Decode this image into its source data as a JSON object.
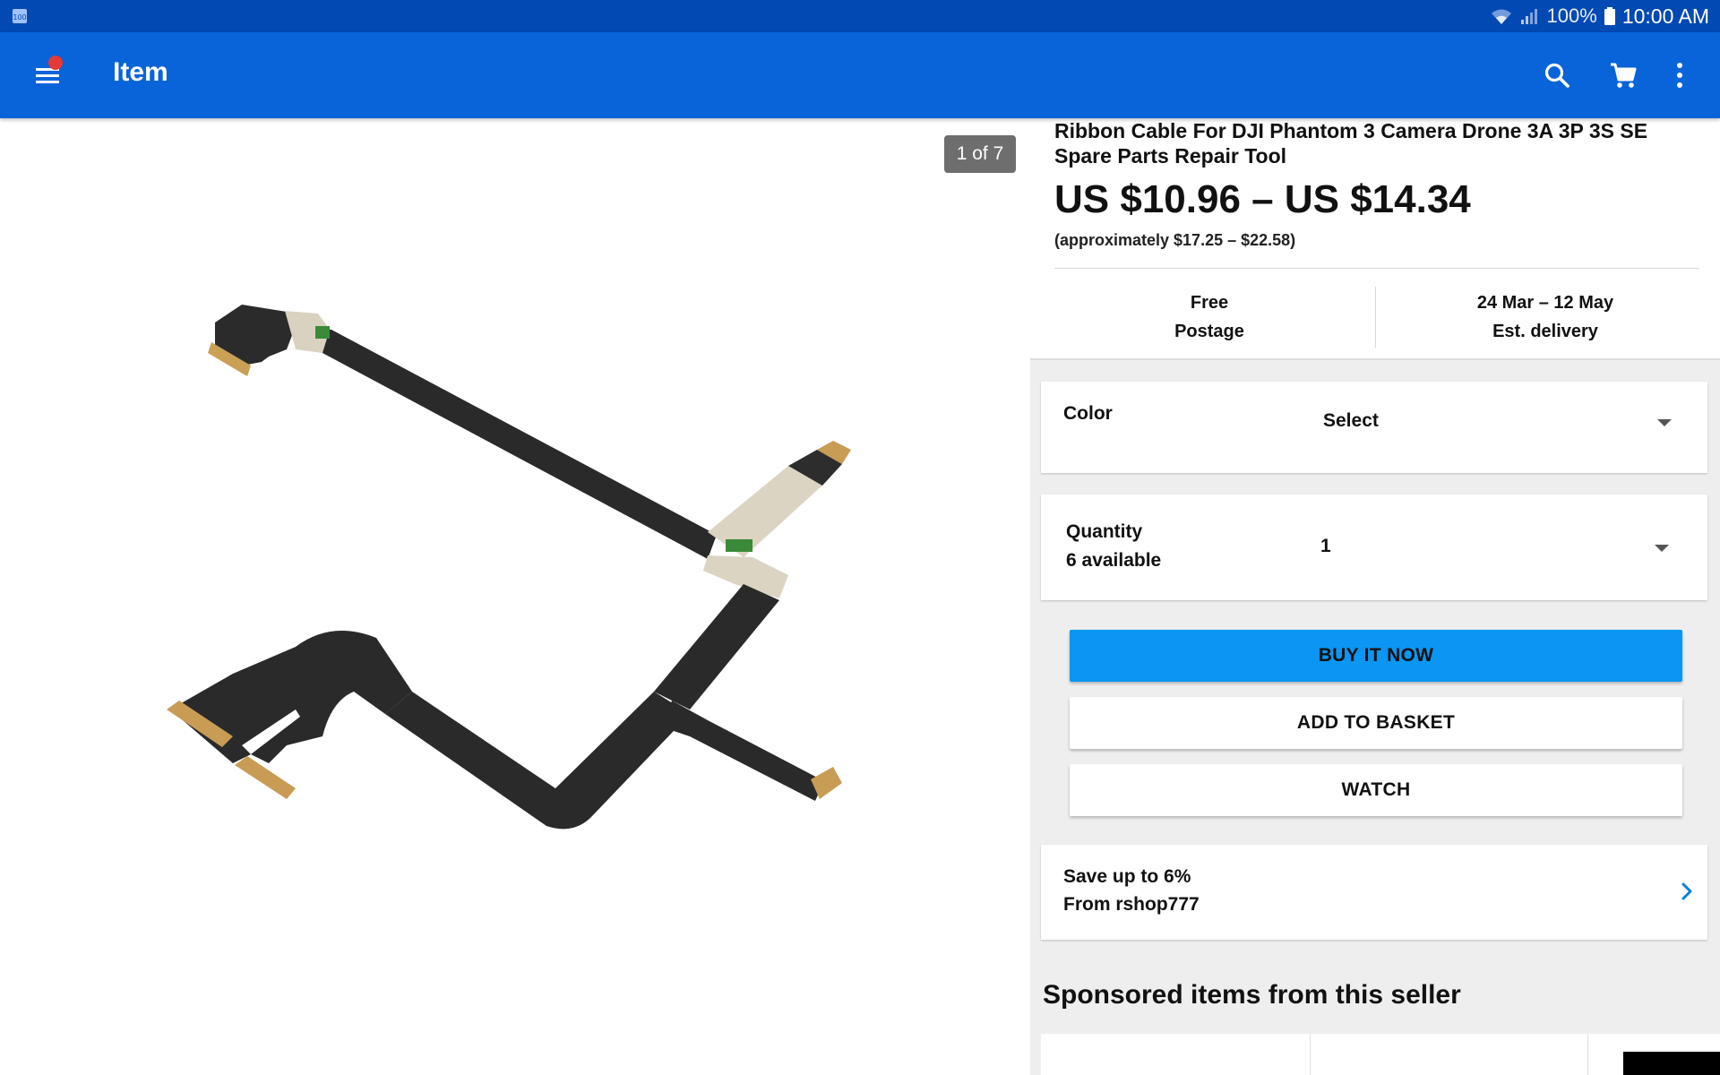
{
  "status_bar": {
    "left_icon": "notification-icon",
    "battery_percent": "100%",
    "time": "10:00 AM",
    "icons": [
      "wifi-icon",
      "signal-icon",
      "battery-icon"
    ]
  },
  "app_bar": {
    "title": "Item",
    "icons": [
      "menu-icon",
      "search-icon",
      "cart-icon",
      "more-vert-icon"
    ],
    "color": "#0864d8"
  },
  "image": {
    "counter": "1 of 7",
    "description_icon": "ribbon-cable-product-image"
  },
  "item": {
    "title": "Ribbon Cable For DJI Phantom 3 Camera Drone 3A 3P 3S SE Spare Parts Repair Tool",
    "price": "US $10.96 – US $14.34",
    "approx": "(approximately $17.25 – $22.58)"
  },
  "shipping": {
    "postage_line1": "Free",
    "postage_line2": "Postage",
    "delivery_line1": "24 Mar – 12 May",
    "delivery_line2": "Est. delivery"
  },
  "options": {
    "color_label": "Color",
    "color_value": "Select",
    "quantity_label": "Quantity",
    "quantity_available": "6 available",
    "quantity_value": "1"
  },
  "buttons": {
    "buy_now": "BUY IT NOW",
    "add_to_basket": "ADD TO BASKET",
    "watch": "WATCH"
  },
  "promo": {
    "line1": "Save up to 6%",
    "line2": "From rshop777"
  },
  "sponsored": {
    "heading": "Sponsored items from this seller"
  },
  "colors": {
    "status_bar": "#0349b4",
    "primary_button": "#0a96f2",
    "chevron": "#0a7fd6"
  }
}
